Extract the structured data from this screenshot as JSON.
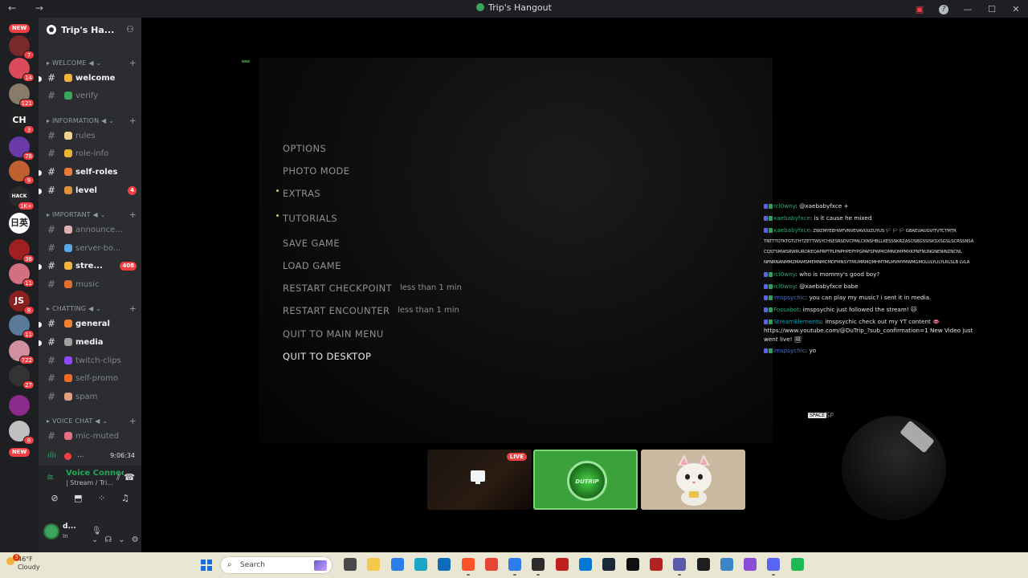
{
  "window": {
    "title": "Trip's Hangout",
    "nav": "← →"
  },
  "rail": {
    "servers": [
      {
        "badge": "7",
        "color": "#7a2a2a",
        "label": ""
      },
      {
        "badge": "14",
        "color": "#d94a5a",
        "label": ""
      },
      {
        "badge": "121",
        "color": "#8a7a6a",
        "label": ""
      },
      {
        "badge": "3",
        "color": "#222222",
        "label": "CH"
      },
      {
        "badge": "78",
        "color": "#6a3aa8",
        "label": ""
      },
      {
        "badge": "9",
        "color": "#c06030",
        "label": ""
      },
      {
        "badge": "1K+",
        "color": "#2a2a2a",
        "label": "HACK"
      },
      {
        "badge": "",
        "color": "#ffffff",
        "label": "日英"
      },
      {
        "badge": "38",
        "color": "#a02020",
        "label": ""
      },
      {
        "badge": "11",
        "color": "#d07080",
        "label": ""
      },
      {
        "badge": "8",
        "color": "#8a2020",
        "label": "JS"
      },
      {
        "badge": "11",
        "color": "#5a7a9a",
        "label": ""
      },
      {
        "badge": "722",
        "color": "#d090a0",
        "label": ""
      },
      {
        "badge": "27",
        "color": "#333333",
        "label": ""
      },
      {
        "badge": "",
        "color": "#8a2a8a",
        "label": ""
      },
      {
        "badge": "8",
        "color": "#c0c0c0",
        "label": ""
      }
    ],
    "new_top": "NEW",
    "new_bottom": "NEW"
  },
  "guild": {
    "name": "Trip's Ha...",
    "invite_icon": "add-member-icon"
  },
  "categories": [
    {
      "name": "WELCOME ◀",
      "plus": "+"
    },
    {
      "name": "INFORMATION ◀",
      "plus": "+"
    },
    {
      "name": "IMPORTANT ◀",
      "plus": "+"
    },
    {
      "name": "CHATTING ◀",
      "plus": "+"
    },
    {
      "name": "VOICE CHAT ◀",
      "plus": "+"
    }
  ],
  "channels": [
    {
      "name": "welcome",
      "emoji_color": "#f2b33d",
      "unread": true,
      "count": ""
    },
    {
      "name": "verify",
      "emoji_color": "#3ba55d",
      "unread": false,
      "count": ""
    },
    {
      "name": "rules",
      "emoji_color": "#f0d28a",
      "unread": false,
      "count": ""
    },
    {
      "name": "role-info",
      "emoji_color": "#e6b430",
      "unread": false,
      "count": ""
    },
    {
      "name": "self-roles",
      "emoji_color": "#e87a3a",
      "unread": true,
      "count": ""
    },
    {
      "name": "level",
      "emoji_color": "#e0903a",
      "unread": true,
      "count": "4"
    },
    {
      "name": "announce...",
      "emoji_color": "#e0b0b0",
      "unread": false,
      "count": ""
    },
    {
      "name": "server-bo...",
      "emoji_color": "#5aa8e8",
      "unread": false,
      "count": ""
    },
    {
      "name": "stre...",
      "emoji_color": "#f2b33d",
      "unread": true,
      "count": "408"
    },
    {
      "name": "music",
      "emoji_color": "#e07030",
      "unread": false,
      "count": ""
    },
    {
      "name": "general",
      "emoji_color": "#f08030",
      "unread": true,
      "count": ""
    },
    {
      "name": "media",
      "emoji_color": "#a0a0a0",
      "unread": true,
      "count": ""
    },
    {
      "name": "twitch-clips",
      "emoji_color": "#9146ff",
      "unread": false,
      "count": ""
    },
    {
      "name": "self-promo",
      "emoji_color": "#f06a2a",
      "unread": false,
      "count": ""
    },
    {
      "name": "spam",
      "emoji_color": "#e0a080",
      "unread": false,
      "count": ""
    },
    {
      "name": "mic-muted",
      "emoji_color": "#e07080",
      "unread": false,
      "count": ""
    }
  ],
  "voice_row": {
    "name": "...",
    "time": "9:06:34"
  },
  "voice_panel": {
    "status": "Voice Connected",
    "sub": "| Stream / Tri..."
  },
  "user": {
    "name": "d...",
    "status": "In"
  },
  "game_menu": {
    "items": [
      {
        "label": "OPTIONS",
        "bullet": false,
        "note": ""
      },
      {
        "label": "PHOTO MODE",
        "bullet": false,
        "note": ""
      },
      {
        "label": "EXTRAS",
        "bullet": true,
        "note": ""
      },
      {
        "label": "TUTORIALS",
        "bullet": true,
        "note": ""
      },
      {
        "label": "SAVE GAME",
        "bullet": false,
        "note": ""
      },
      {
        "label": "LOAD GAME",
        "bullet": false,
        "note": ""
      },
      {
        "label": "RESTART CHECKPOINT",
        "bullet": false,
        "note": "less than 1 min"
      },
      {
        "label": "RESTART ENCOUNTER",
        "bullet": false,
        "note": "less than 1 min"
      },
      {
        "label": "QUIT TO MAIN MENU",
        "bullet": false,
        "note": ""
      },
      {
        "label": "QUIT TO DESKTOP",
        "bullet": false,
        "note": "",
        "active": true
      }
    ]
  },
  "chat": {
    "messages": [
      {
        "user": "rcl0wny",
        "text": ": @xaebabyfxce +",
        "color": "#21b07a"
      },
      {
        "user": "xaebabyfxce",
        "text": ": is it cause he mixed",
        "color": "#21b07a"
      },
      {
        "user": "xaebabyfxce",
        "text": ": ZWZMYEEHWFVNVEVAVUUZUYUS 🏳 🏳 🏳 GBAEUAUGVITVTCTMTR TNTTTOTKTGTLTHTZETTWSYCHSESRSDVCPMLCKNSHBLLKESSSKRZASOSBGSSISKSXSGSLSCRSSNSA CQSTSMWSRWRUROREQAPRPTPLPNPHPEPYPGPAPSPWPKOMNOMPMXKPNFNUNGNENINZNCNL NPNRNANMMZMAMSMEMNMCMDFMNSYTMUMRMQMHMTMLMVMYMWMGMOLULYLILYLRLSLB LVLA",
        "color": "#21b07a",
        "small": true
      },
      {
        "user": "rcl0wny",
        "text": ": who is mommy's good boy?",
        "color": "#21b07a"
      },
      {
        "user": "rcl0wny",
        "text": ": @xaebabyfxce babe",
        "color": "#21b07a"
      },
      {
        "user": "imspsychic",
        "text": ": you can play my music? i sent it in media.",
        "color": "#4a6ee0"
      },
      {
        "user": "Fossabot",
        "text": ": imspsychic just followed the stream! 🐱",
        "color": "#21b07a"
      },
      {
        "user": "StreamElements",
        "text": ": imspsychic check out my YT content 👄 https://www.youtube.com/@DuTrip_?sub_confirmation=1 New Video just went live! 🖼",
        "color": "#13a0c0",
        "wrap": true
      },
      {
        "user": "imspsychic",
        "text": ": yo",
        "color": "#4a6ee0"
      }
    ]
  },
  "tiles": {
    "live": "LIVE",
    "ring_text": "DUTRIP"
  },
  "webcam": {
    "key": "SPACE",
    "key_text": "SP"
  },
  "taskbar": {
    "weather_temp": "46°F",
    "weather_desc": "Cloudy",
    "weather_badge": "3",
    "search": "Search",
    "apps": [
      {
        "name": "task-view-icon",
        "color": "#4a4a4a"
      },
      {
        "name": "file-explorer-icon",
        "color": "#f2c94c"
      },
      {
        "name": "store-icon",
        "color": "#2b7de9"
      },
      {
        "name": "edge-icon",
        "color": "#1aa6c6"
      },
      {
        "name": "outlook-icon",
        "color": "#0f6cbd"
      },
      {
        "name": "brave-icon",
        "color": "#fb542b"
      },
      {
        "name": "chrome-icon",
        "color": "#e94335"
      },
      {
        "name": "calculator-icon",
        "color": "#2b7de9"
      },
      {
        "name": "obs-icon",
        "color": "#2b2b2b"
      },
      {
        "name": "record-icon",
        "color": "#c11e1e"
      },
      {
        "name": "app-icon",
        "color": "#0078d4"
      },
      {
        "name": "steam-icon",
        "color": "#1b2838"
      },
      {
        "name": "capcut-icon",
        "color": "#111111"
      },
      {
        "name": "game-icon",
        "color": "#b22222"
      },
      {
        "name": "diamond-icon",
        "color": "#5a5aaa"
      },
      {
        "name": "terminal-icon",
        "color": "#1e1e1e"
      },
      {
        "name": "photos-icon",
        "color": "#3a86c8"
      },
      {
        "name": "grid-app-icon",
        "color": "#8a4dd8"
      },
      {
        "name": "discord-icon",
        "color": "#5865f2"
      },
      {
        "name": "spotify-icon",
        "color": "#1db954"
      }
    ]
  }
}
